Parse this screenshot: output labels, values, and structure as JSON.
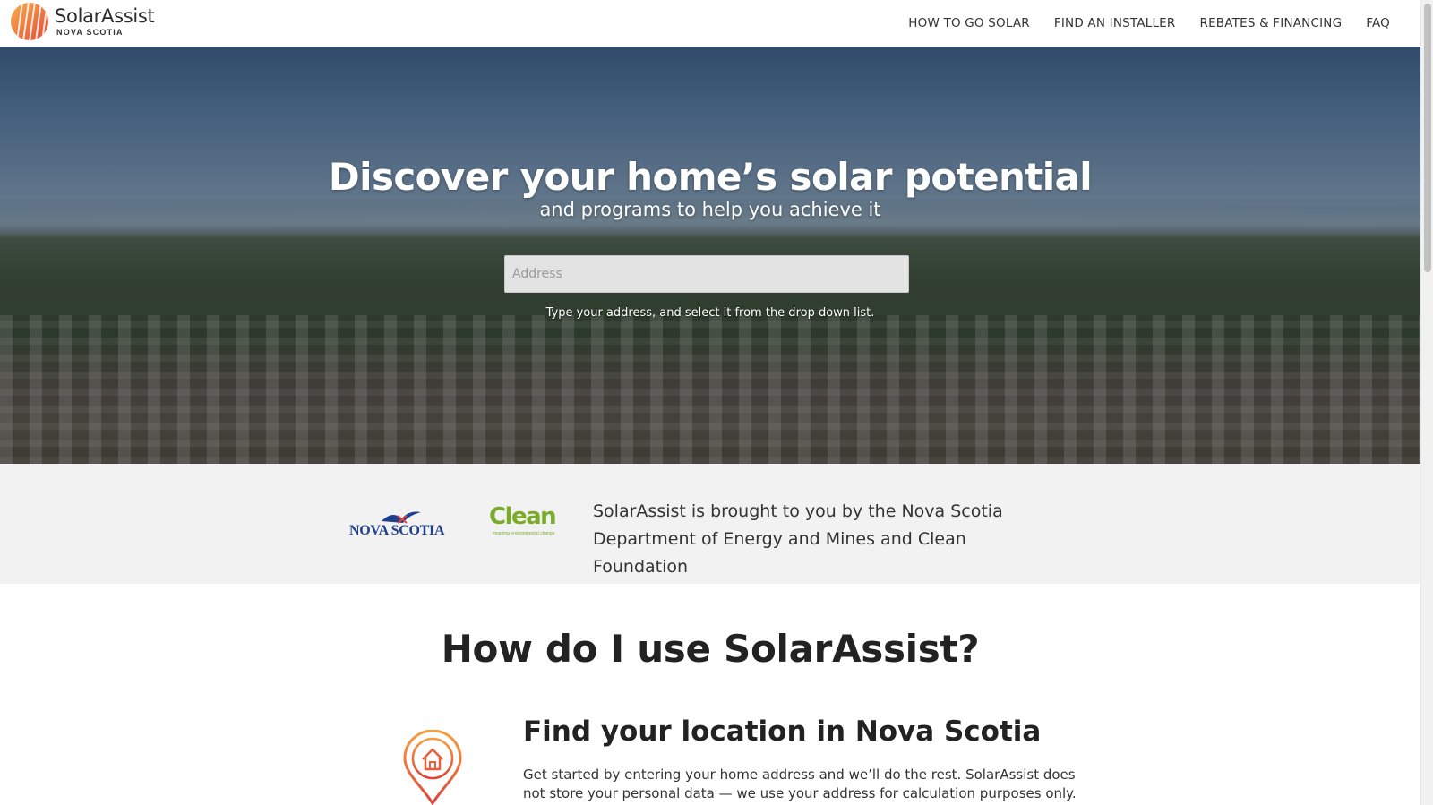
{
  "header": {
    "logo": {
      "name": "SolarAssist",
      "subtitle": "NOVA SCOTIA",
      "icon": "sun-stripes-logo-icon"
    },
    "nav": [
      {
        "label": "HOW TO GO SOLAR"
      },
      {
        "label": "FIND AN INSTALLER"
      },
      {
        "label": "REBATES & FINANCING"
      },
      {
        "label": "FAQ"
      }
    ]
  },
  "hero": {
    "title": "Discover your home’s solar potential",
    "subtitle": "and programs to help you achieve it",
    "address_placeholder": "Address",
    "address_value": "",
    "hint": "Type your address, and select it from the drop down list."
  },
  "partners": {
    "nova_scotia_logo": "NOVA SCOTIA",
    "clean_logo": "Clean",
    "clean_tagline": "Inspiring environmental change",
    "text": "SolarAssist is brought to you by the Nova Scotia Department of Energy and Mines and Clean Foundation"
  },
  "how": {
    "title": "How do I use SolarAssist?",
    "steps": [
      {
        "icon": "location-pin-house-icon",
        "title": "Find your location in Nova Scotia",
        "text": "Get started by entering your home address and we’ll do the rest. SolarAssist does not store your personal data — we use your address for calculation purposes only."
      }
    ]
  },
  "colors": {
    "accent_orange": "#f08a3c",
    "accent_red": "#e0453a",
    "ns_blue": "#1f3f8f",
    "clean_green": "#7bab2a",
    "band_gray": "#f2f2f2"
  }
}
